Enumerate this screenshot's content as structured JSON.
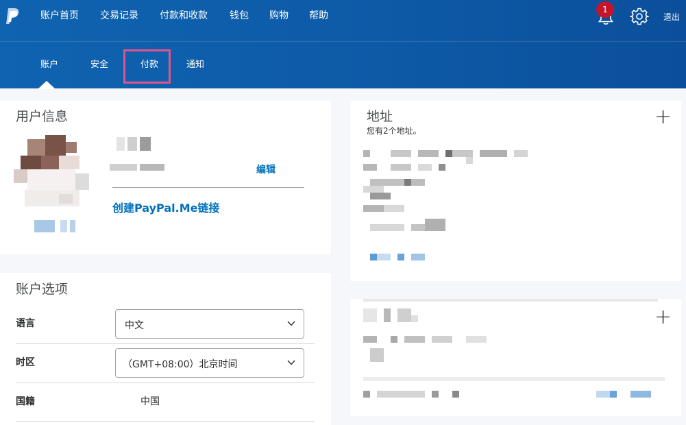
{
  "topnav": {
    "items": [
      "账户首页",
      "交易记录",
      "付款和收款",
      "钱包",
      "购物",
      "帮助"
    ],
    "notification_count": "1",
    "logout": "退出"
  },
  "subnav": {
    "items": [
      "账户",
      "安全",
      "付款",
      "通知"
    ],
    "active_index": 0,
    "highlighted_index": 2
  },
  "user_info": {
    "title": "用户信息",
    "edit": "编辑",
    "paypal_me_link": "创建PayPal.Me链接"
  },
  "account_options": {
    "title": "账户选项",
    "language_label": "语言",
    "language_value": "中文",
    "timezone_label": "时区",
    "timezone_value": "（GMT+08:00）北京时间",
    "nationality_label": "国籍",
    "nationality_value": "中国"
  },
  "address": {
    "title": "地址",
    "subtitle": "您有2个地址。",
    "add_symbol": "+"
  },
  "second_card": {
    "add_symbol": "+"
  },
  "colors": {
    "header_blue": "#0e5ba8",
    "link_blue": "#0070ba",
    "badge_red": "#c4152a",
    "highlight_pink": "#e3548a"
  },
  "icons": {
    "logo": "paypal-logo",
    "bell": "bell-icon",
    "gear": "gear-icon",
    "chevron": "chevron-down-icon"
  }
}
